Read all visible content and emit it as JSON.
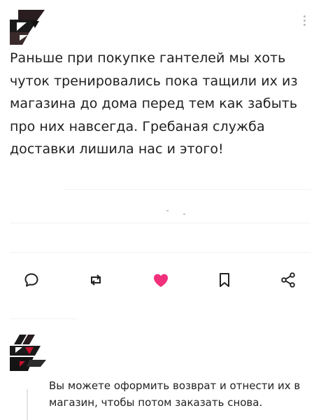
{
  "post": {
    "text": "Раньше при покупке гантелей мы хоть чуток тренировались пока тащили их из магазина до дома перед тем как забыть про них навсегда. Гребаная служба доставки лишила нас и этого!"
  },
  "actions": [
    {
      "name": "comment",
      "icon": "speech-bubble-icon"
    },
    {
      "name": "repost",
      "icon": "repost-arrows-icon"
    },
    {
      "name": "like",
      "icon": "heart-icon",
      "active": true
    },
    {
      "name": "bookmark",
      "icon": "bookmark-icon"
    },
    {
      "name": "share",
      "icon": "share-icon"
    }
  ],
  "colors": {
    "like_active": "#f0307a",
    "icon": "#222222",
    "text": "#1f1f1f"
  },
  "reply": {
    "text": "Вы можете оформить возврат и отнести их в магазин, чтобы потом заказать снова."
  }
}
